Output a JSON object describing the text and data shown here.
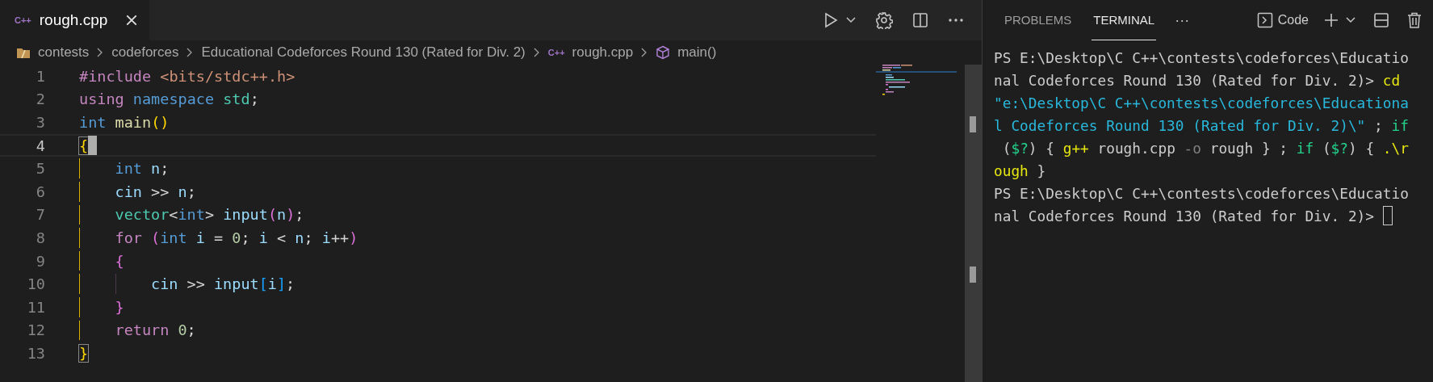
{
  "editor": {
    "tab": {
      "icon_text": "C++",
      "label": "rough.cpp",
      "selected": true
    },
    "breadcrumb": [
      {
        "kind": "folder",
        "text": "contests"
      },
      {
        "kind": "plain",
        "text": "codeforces"
      },
      {
        "kind": "plain",
        "text": "Educational Codeforces Round 130 (Rated for Div. 2)"
      },
      {
        "kind": "file",
        "icon_text": "C++",
        "text": "rough.cpp"
      },
      {
        "kind": "symbol",
        "text": "main()"
      }
    ],
    "lines": [
      {
        "number": "1",
        "current": false,
        "tokens": [
          {
            "kind": "directive",
            "text": "#include"
          },
          {
            "kind": "string",
            "text": " <bits/stdc++.h>"
          }
        ]
      },
      {
        "number": "2",
        "current": false,
        "tokens": [
          {
            "kind": "control",
            "text": "using"
          },
          {
            "kind": "keyword",
            "text": " namespace"
          },
          {
            "kind": "type",
            "text": " std"
          },
          {
            "kind": "plain",
            "text": ";"
          }
        ]
      },
      {
        "number": "3",
        "current": false,
        "tokens": [
          {
            "kind": "keyword",
            "text": "int"
          },
          {
            "kind": "function",
            "text": " main"
          },
          {
            "kind": "bracket1",
            "text": "()"
          }
        ]
      },
      {
        "number": "4",
        "current": true,
        "tokens": [
          {
            "kind": "bracket-match",
            "text": "{"
          }
        ],
        "children": [
          {
            "number": "5",
            "current": false,
            "tokens": [
              {
                "kind": "keyword",
                "text": "int"
              },
              {
                "kind": "variable",
                "text": " n"
              },
              {
                "kind": "plain",
                "text": ";"
              }
            ]
          },
          {
            "number": "6",
            "current": false,
            "tokens": [
              {
                "kind": "variable",
                "text": "cin"
              },
              {
                "kind": "operator",
                "text": " >> "
              },
              {
                "kind": "variable",
                "text": "n"
              },
              {
                "kind": "plain",
                "text": ";"
              }
            ]
          },
          {
            "number": "7",
            "current": false,
            "tokens": [
              {
                "kind": "type",
                "text": "vector"
              },
              {
                "kind": "plain",
                "text": "<"
              },
              {
                "kind": "keyword",
                "text": "int"
              },
              {
                "kind": "plain",
                "text": "> "
              },
              {
                "kind": "variable",
                "text": "input"
              },
              {
                "kind": "bracket2",
                "text": "("
              },
              {
                "kind": "variable",
                "text": "n"
              },
              {
                "kind": "bracket2",
                "text": ")"
              },
              {
                "kind": "plain",
                "text": ";"
              }
            ]
          },
          {
            "number": "8",
            "current": false,
            "tokens": [
              {
                "kind": "control",
                "text": "for "
              },
              {
                "kind": "bracket2",
                "text": "("
              },
              {
                "kind": "keyword",
                "text": "int"
              },
              {
                "kind": "variable",
                "text": " i"
              },
              {
                "kind": "plain",
                "text": " = "
              },
              {
                "kind": "number",
                "text": "0"
              },
              {
                "kind": "plain",
                "text": "; "
              },
              {
                "kind": "variable",
                "text": "i"
              },
              {
                "kind": "plain",
                "text": " < "
              },
              {
                "kind": "variable",
                "text": "n"
              },
              {
                "kind": "plain",
                "text": "; "
              },
              {
                "kind": "variable",
                "text": "i"
              },
              {
                "kind": "plain",
                "text": "++"
              },
              {
                "kind": "bracket2",
                "text": ")"
              }
            ]
          },
          {
            "number": "9",
            "current": false,
            "tokens": [
              {
                "kind": "bracket2",
                "text": "{"
              }
            ],
            "children": [
              {
                "number": "10",
                "current": false,
                "tokens": [
                  {
                    "kind": "variable",
                    "text": "cin"
                  },
                  {
                    "kind": "operator",
                    "text": " >> "
                  },
                  {
                    "kind": "variable",
                    "text": "input"
                  },
                  {
                    "kind": "bracket3",
                    "text": "["
                  },
                  {
                    "kind": "variable",
                    "text": "i"
                  },
                  {
                    "kind": "bracket3",
                    "text": "]"
                  },
                  {
                    "kind": "plain",
                    "text": ";"
                  }
                ]
              }
            ]
          },
          {
            "number": "11",
            "current": false,
            "tokens": [
              {
                "kind": "bracket2",
                "text": "}"
              }
            ]
          },
          {
            "number": "12",
            "current": false,
            "tokens": [
              {
                "kind": "control",
                "text": "return"
              },
              {
                "kind": "number",
                "text": " 0"
              },
              {
                "kind": "plain",
                "text": ";"
              }
            ]
          }
        ]
      },
      {
        "number": "13",
        "current": false,
        "tokens": [
          {
            "kind": "bracket-match",
            "text": "}"
          }
        ]
      }
    ]
  },
  "panel": {
    "tabs": [
      {
        "label": "PROBLEMS",
        "selected": false
      },
      {
        "label": "TERMINAL",
        "selected": true
      }
    ],
    "more": "···",
    "terminal_name": "Code",
    "terminal_lines": [
      {
        "cursor": false,
        "segments": [
          {
            "kind": "plain",
            "text": "PS E:\\Desktop\\C C++\\contests\\codeforces\\Educatio"
          }
        ]
      },
      {
        "cursor": false,
        "segments": [
          {
            "kind": "plain",
            "text": "nal Codeforces Round 130 (Rated for Div. 2)> "
          },
          {
            "kind": "command",
            "text": "cd"
          }
        ]
      },
      {
        "cursor": false,
        "segments": [
          {
            "kind": "string",
            "text": "\"e:\\Desktop\\C C++\\contests\\codeforces\\Educationa"
          }
        ]
      },
      {
        "cursor": false,
        "segments": [
          {
            "kind": "string",
            "text": "l Codeforces Round 130 (Rated for Div. 2)\\\""
          },
          {
            "kind": "plain",
            "text": " ; "
          },
          {
            "kind": "keyword",
            "text": "if"
          }
        ]
      },
      {
        "cursor": false,
        "segments": [
          {
            "kind": "plain",
            "text": " ("
          },
          {
            "kind": "keyword",
            "text": "$?"
          },
          {
            "kind": "plain",
            "text": ") { "
          },
          {
            "kind": "command",
            "text": "g++"
          },
          {
            "kind": "plain",
            "text": " rough.cpp "
          },
          {
            "kind": "param",
            "text": "-o"
          },
          {
            "kind": "plain",
            "text": " rough } ; "
          },
          {
            "kind": "keyword",
            "text": "if"
          },
          {
            "kind": "plain",
            "text": " ("
          },
          {
            "kind": "keyword",
            "text": "$?"
          },
          {
            "kind": "plain",
            "text": ") { "
          },
          {
            "kind": "command",
            "text": ".\\r"
          }
        ]
      },
      {
        "cursor": false,
        "segments": [
          {
            "kind": "command",
            "text": "ough"
          },
          {
            "kind": "plain",
            "text": " }"
          }
        ]
      },
      {
        "cursor": false,
        "segments": [
          {
            "kind": "plain",
            "text": "PS E:\\Desktop\\C C++\\contests\\codeforces\\Educatio"
          }
        ]
      },
      {
        "cursor": true,
        "segments": [
          {
            "kind": "plain",
            "text": "nal Codeforces Round 130 (Rated for Div. 2)> "
          }
        ]
      }
    ]
  }
}
